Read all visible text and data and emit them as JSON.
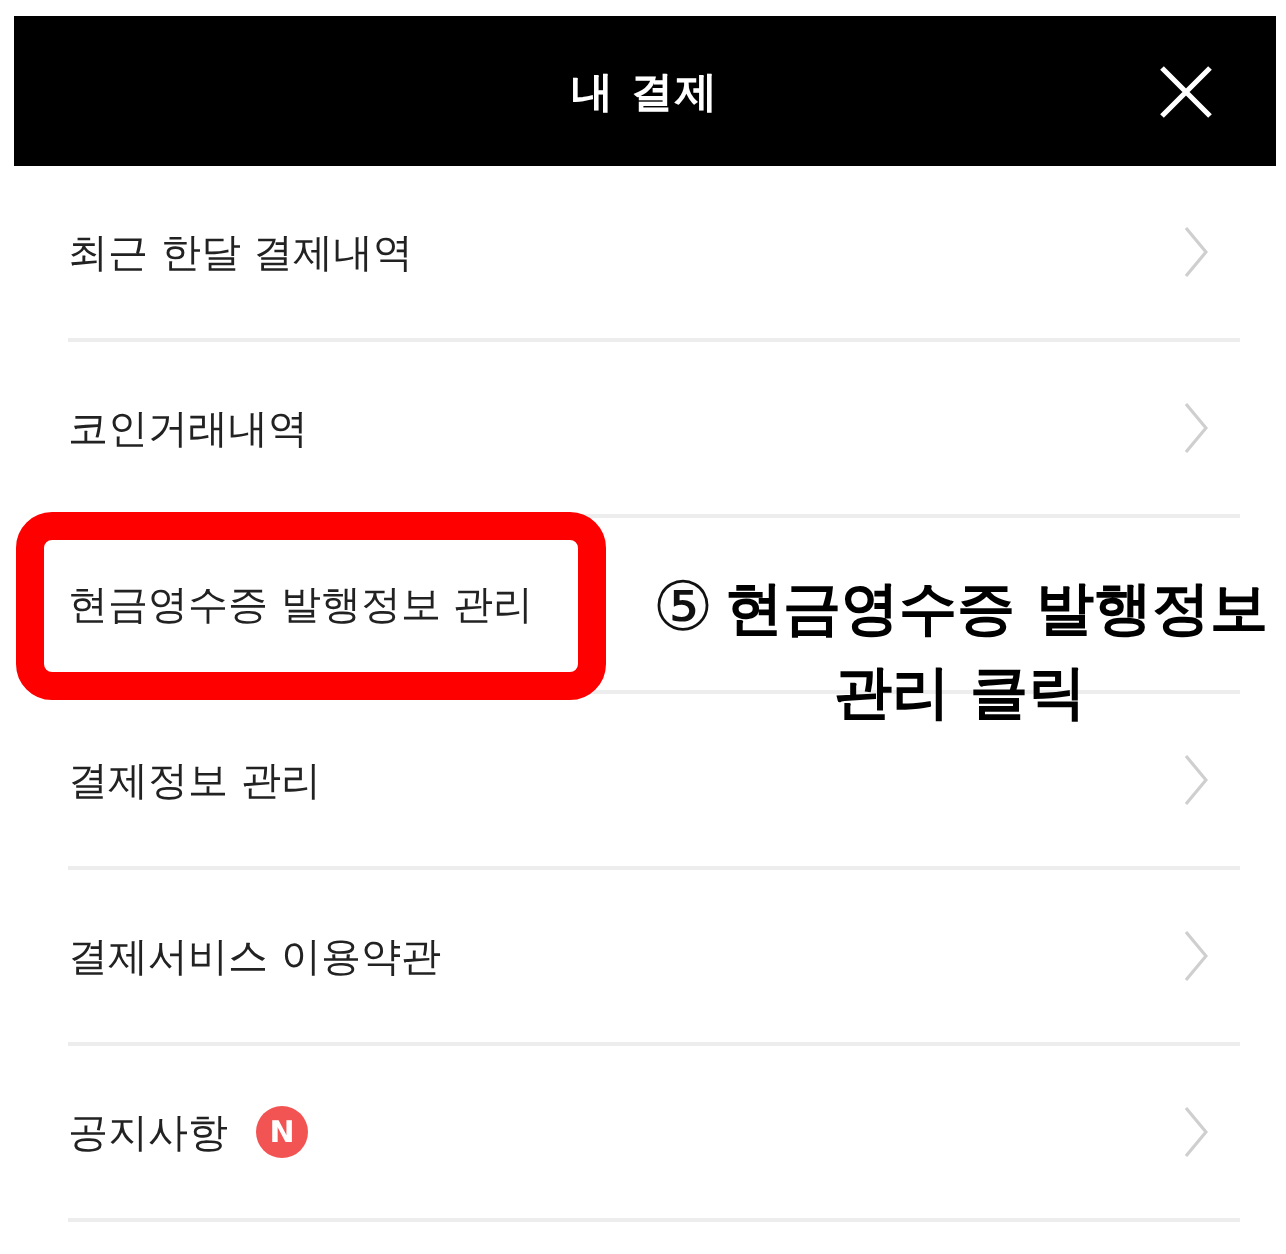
{
  "header": {
    "title": "내 결제"
  },
  "items": [
    {
      "label": "최근 한달 결제내역",
      "highlighted": false
    },
    {
      "label": "코인거래내역",
      "highlighted": false
    },
    {
      "label": "현금영수증 발행정보 관리",
      "highlighted": true,
      "annotation": {
        "marker": "⑤",
        "lines": [
          "현금영수증 발행정보",
          "관리 클릭"
        ]
      }
    },
    {
      "label": "결제정보 관리",
      "highlighted": false
    },
    {
      "label": "결제서비스 이용약관",
      "highlighted": false
    },
    {
      "label": "공지사항",
      "highlighted": false,
      "badge": "N"
    }
  ]
}
